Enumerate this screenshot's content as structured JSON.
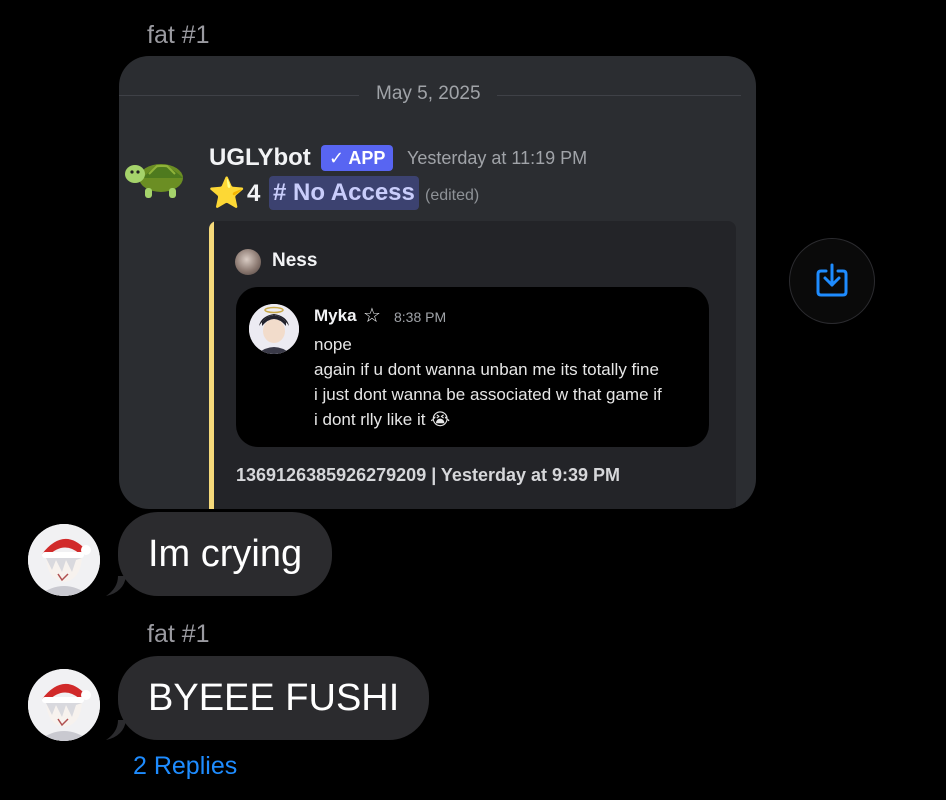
{
  "messages": [
    {
      "sender": "fat #1",
      "attachment": {
        "date_divider": "May 5, 2025",
        "bot": {
          "name": "UGLYbot",
          "badge": "✓ APP",
          "timestamp": "Yesterday at 11:19 PM",
          "star_icon": "⭐",
          "star_count": "4",
          "channel_mention": "# No Access",
          "edited_label": "(edited)"
        },
        "embed": {
          "author": "Ness",
          "quoted": {
            "author": "Myka",
            "author_suffix": "☆",
            "time": "8:38 PM",
            "lines": [
              "nope",
              "again if u dont wanna unban me its totally fine",
              "i just dont wanna be associated w that game if",
              "i dont rlly like it"
            ],
            "emoji": "😭"
          },
          "footer": "1369126385926279209 | Yesterday at 9:39 PM"
        }
      },
      "bubble_text": "Im crying"
    },
    {
      "sender": "fat #1",
      "bubble_text": "BYEEE FUSHI",
      "replies_label": "2 Replies"
    }
  ],
  "colors": {
    "background": "#000000",
    "bubble": "#2b2b2e",
    "accent_link": "#1e8cff",
    "embed_bar": "#f5d97a",
    "app_badge": "#5865f2"
  }
}
